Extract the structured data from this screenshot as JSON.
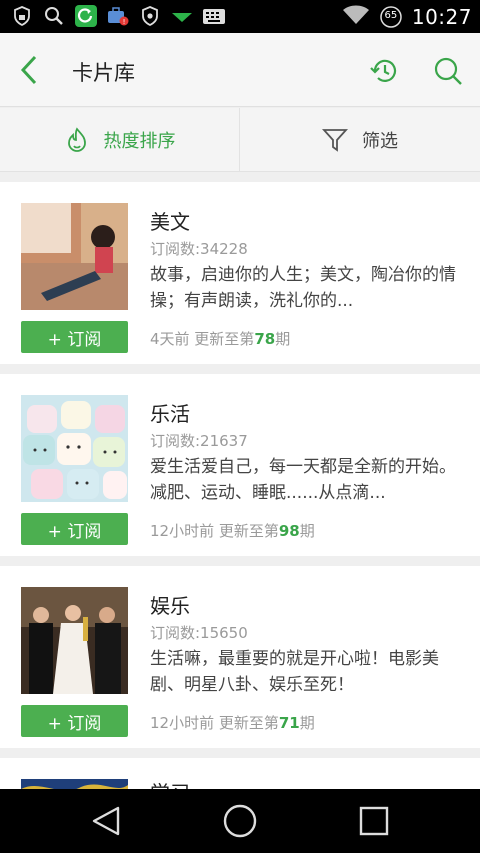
{
  "status_bar": {
    "time": "10:27",
    "battery_level": "65",
    "icons": [
      "shield-lock-icon",
      "search-icon",
      "refresh-app-icon",
      "briefcase-alert-icon",
      "shield-icon",
      "download-arrow-icon",
      "keyboard-icon",
      "wifi-icon",
      "battery-icon"
    ]
  },
  "header": {
    "title": "卡片库",
    "icons": [
      "back-arrow-icon",
      "history-icon",
      "search-icon"
    ],
    "accent": "#3aa54a"
  },
  "sortbar": {
    "hot_label": "热度排序",
    "filter_label": "筛选"
  },
  "cards": [
    {
      "title": "美文",
      "subscribers": "订阅数:34228",
      "description": "故事，启迪你的人生；美文，陶冶你的情操；有声朗读，洗礼你的...",
      "update_prefix": "4天前 更新至第",
      "issue": "78",
      "update_suffix": "期",
      "subscribe_label": "+ 订阅"
    },
    {
      "title": "乐活",
      "subscribers": "订阅数:21637",
      "description": "爱生活爱自己，每一天都是全新的开始。减肥、运动、睡眠......从点滴...",
      "update_prefix": "12小时前 更新至第",
      "issue": "98",
      "update_suffix": "期",
      "subscribe_label": "+ 订阅"
    },
    {
      "title": "娱乐",
      "subscribers": "订阅数:15650",
      "description": "生活嘛，最重要的就是开心啦！电影美剧、明星八卦、娱乐至死！",
      "update_prefix": "12小时前 更新至第",
      "issue": "71",
      "update_suffix": "期",
      "subscribe_label": "+ 订阅"
    },
    {
      "title": "学习"
    }
  ],
  "nav_bar": {
    "icons": [
      "back-triangle-icon",
      "home-circle-icon",
      "recents-square-icon"
    ]
  }
}
